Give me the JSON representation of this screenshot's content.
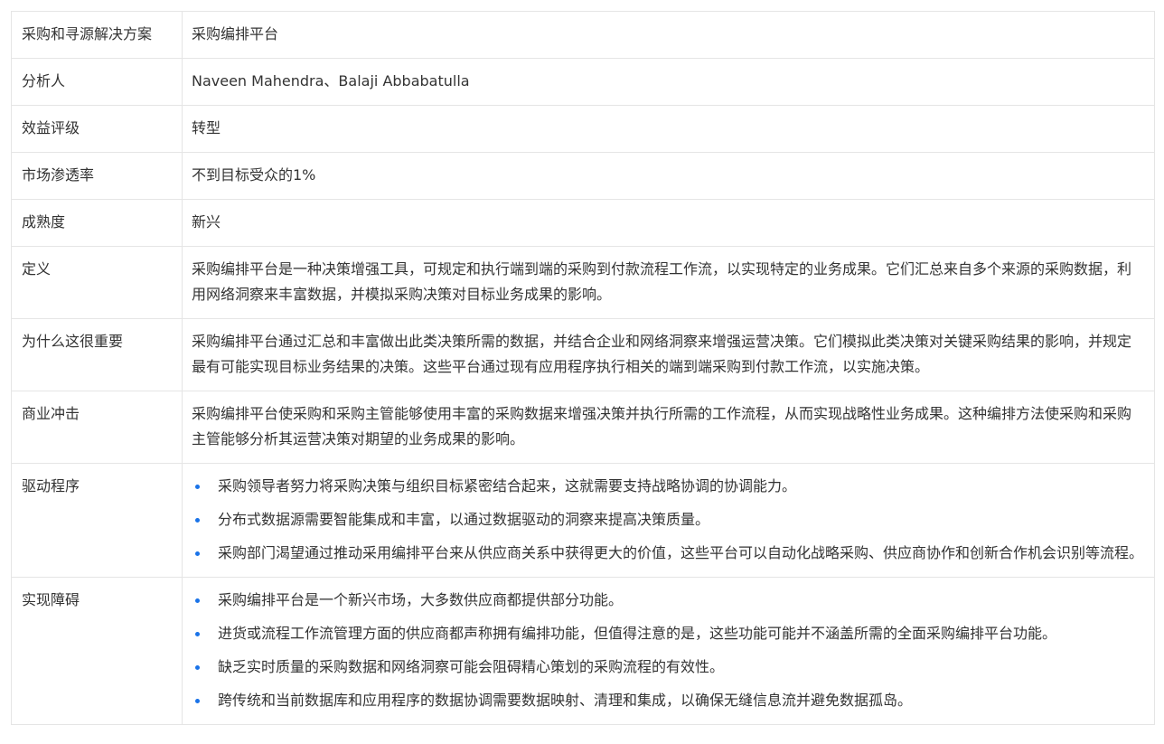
{
  "theme": {
    "bullet_color": "#1a73e8",
    "border_color": "#e5e5e5",
    "text_color": "#333333"
  },
  "rows": {
    "solution": {
      "label": "采购和寻源解决方案",
      "value": "采购编排平台"
    },
    "analyst": {
      "label": "分析人",
      "value": "Naveen Mahendra、Balaji Abbabatulla"
    },
    "benefit": {
      "label": "效益评级",
      "value": "转型"
    },
    "penetration": {
      "label": "市场渗透率",
      "value": "不到目标受众的1%"
    },
    "maturity": {
      "label": "成熟度",
      "value": "新兴"
    },
    "definition": {
      "label": "定义",
      "value": "采购编排平台是一种决策增强工具，可规定和执行端到端的采购到付款流程工作流，以实现特定的业务成果。它们汇总来自多个来源的采购数据，利用网络洞察来丰富数据，并模拟采购决策对目标业务成果的影响。"
    },
    "importance": {
      "label": "为什么这很重要",
      "value": "采购编排平台通过汇总和丰富做出此类决策所需的数据，并结合企业和网络洞察来增强运营决策。它们模拟此类决策对关键采购结果的影响，并规定最有可能实现目标业务结果的决策。这些平台通过现有应用程序执行相关的端到端采购到付款工作流，以实施决策。"
    },
    "impact": {
      "label": "商业冲击",
      "value": "采购编排平台使采购和采购主管能够使用丰富的采购数据来增强决策并执行所需的工作流程，从而实现战略性业务成果。这种编排方法使采购和采购主管能够分析其运营决策对期望的业务成果的影响。"
    },
    "drivers": {
      "label": "驱动程序",
      "items": [
        "采购领导者努力将采购决策与组织目标紧密结合起来，这就需要支持战略协调的协调能力。",
        "分布式数据源需要智能集成和丰富，以通过数据驱动的洞察来提高决策质量。",
        "采购部门渴望通过推动采用编排平台来从供应商关系中获得更大的价值，这些平台可以自动化战略采购、供应商协作和创新合作机会识别等流程。"
      ]
    },
    "obstacles": {
      "label": "实现障碍",
      "items": [
        "采购编排平台是一个新兴市场，大多数供应商都提供部分功能。",
        "进货或流程工作流管理方面的供应商都声称拥有编排功能，但值得注意的是，这些功能可能并不涵盖所需的全面采购编排平台功能。",
        "缺乏实时质量的采购数据和网络洞察可能会阻碍精心策划的采购流程的有效性。",
        "跨传统和当前数据库和应用程序的数据协调需要数据映射、清理和集成，以确保无缝信息流并避免数据孤岛。"
      ]
    }
  }
}
